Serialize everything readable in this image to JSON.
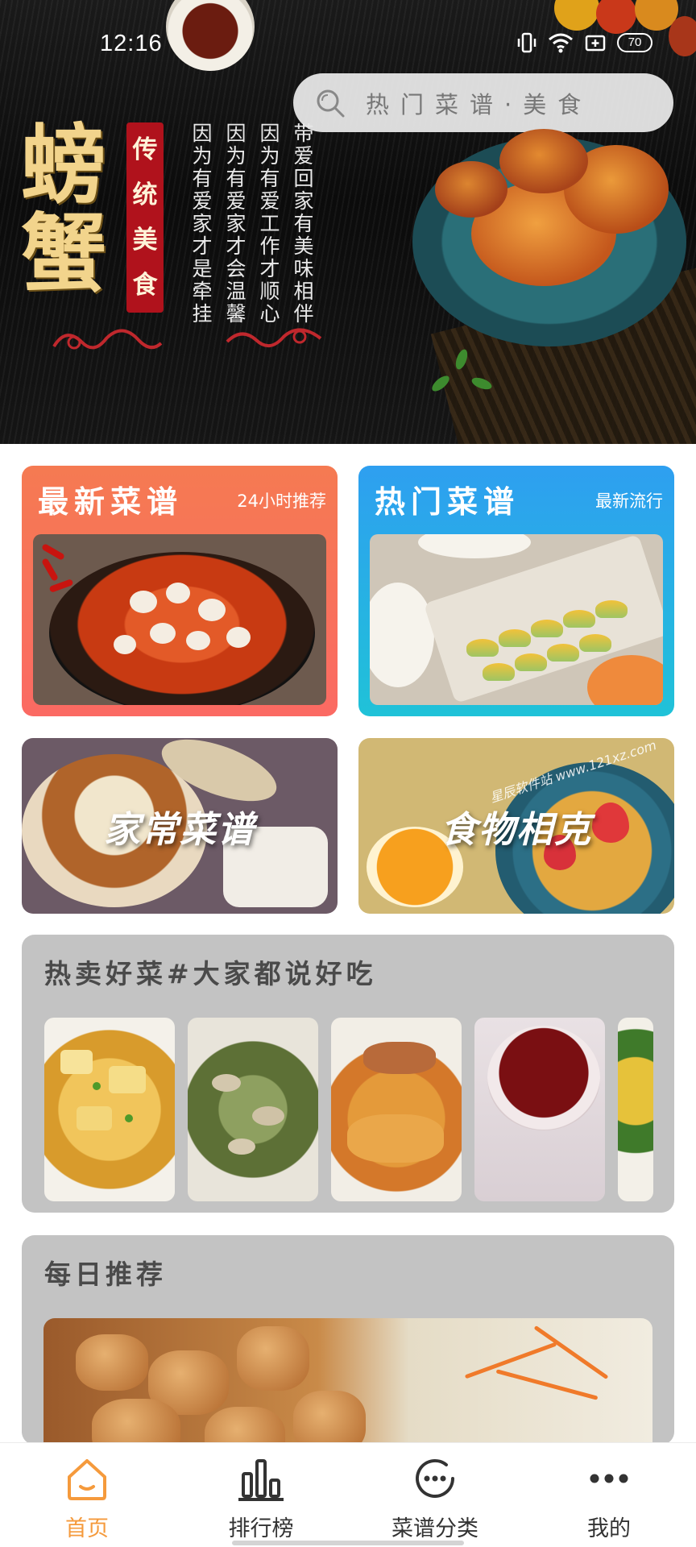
{
  "status_bar": {
    "time": "12:16",
    "battery": "70"
  },
  "hero": {
    "title_chars": [
      "螃",
      "蟹"
    ],
    "tag_chars": [
      "传",
      "统",
      "美",
      "食"
    ],
    "poem_lines": [
      "因为有爱家才是牵挂",
      "因为有爱家才会温馨",
      "因为有爱工作才顺心",
      "带爱回家有美味相伴"
    ]
  },
  "search": {
    "placeholder": "热门菜谱·美食"
  },
  "cards": {
    "latest": {
      "title": "最新菜谱",
      "subtitle": "24小时推荐"
    },
    "hot": {
      "title": "热门菜谱",
      "subtitle": "最新流行"
    },
    "home": {
      "title": "家常菜谱"
    },
    "food_conflict": {
      "title": "食物相克",
      "watermark": "星辰软件站 www.121xz.com"
    }
  },
  "hot_sale": {
    "title": "热卖好菜#大家都说好吃"
  },
  "daily": {
    "title": "每日推荐"
  },
  "nav": {
    "items": [
      {
        "label": "首页",
        "icon": "home-icon",
        "active": true
      },
      {
        "label": "排行榜",
        "icon": "ranking-icon",
        "active": false
      },
      {
        "label": "菜谱分类",
        "icon": "category-icon",
        "active": false
      },
      {
        "label": "我的",
        "icon": "more-icon",
        "active": false
      }
    ]
  },
  "colors": {
    "accent": "#f59a3c",
    "card_latest": "#f57a52",
    "card_hot": "#2e9ff0",
    "panel_bg": "#c3c3c3"
  }
}
